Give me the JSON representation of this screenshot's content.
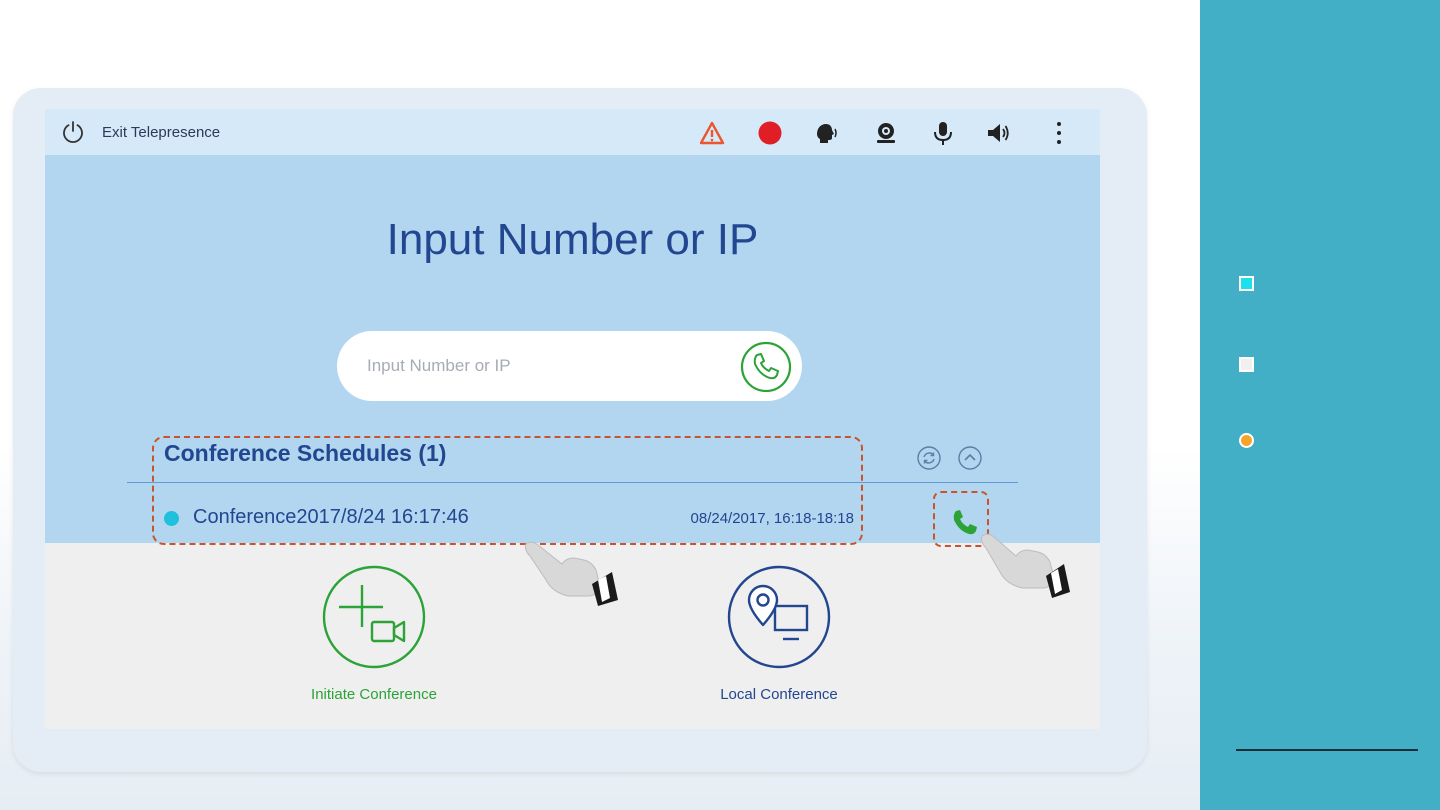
{
  "topbar": {
    "exit_label": "Exit Telepresence",
    "icons": [
      "power-icon",
      "warning-icon",
      "record-icon",
      "speaker-voice-icon",
      "camera-icon",
      "microphone-icon",
      "volume-icon",
      "more-vertical-icon"
    ]
  },
  "main": {
    "title": "Input Number or IP",
    "search": {
      "placeholder": "Input Number or IP",
      "value": ""
    },
    "schedules": {
      "title": "Conference Schedules (1)",
      "items": [
        {
          "name": "Conference2017/8/24 16:17:46",
          "time": "08/24/2017, 16:18-18:18",
          "status_color": "#1ec0dc"
        }
      ]
    },
    "actions": [
      {
        "label": "Initiate Conference",
        "icon": "add-video-icon",
        "color": "#2ba336"
      },
      {
        "label": "Local Conference",
        "icon": "location-screen-icon",
        "color": "#22468f"
      }
    ]
  },
  "colors": {
    "accent_blue": "#22468f",
    "call_green": "#2ba336",
    "highlight_dash": "#c9532c",
    "panel_teal": "#43afc6"
  },
  "right_panel": {
    "bullets": [
      {
        "color": "#1ee0ea"
      },
      {
        "color": "#f0f0f0"
      },
      {
        "color": "#f7a52a"
      }
    ]
  }
}
